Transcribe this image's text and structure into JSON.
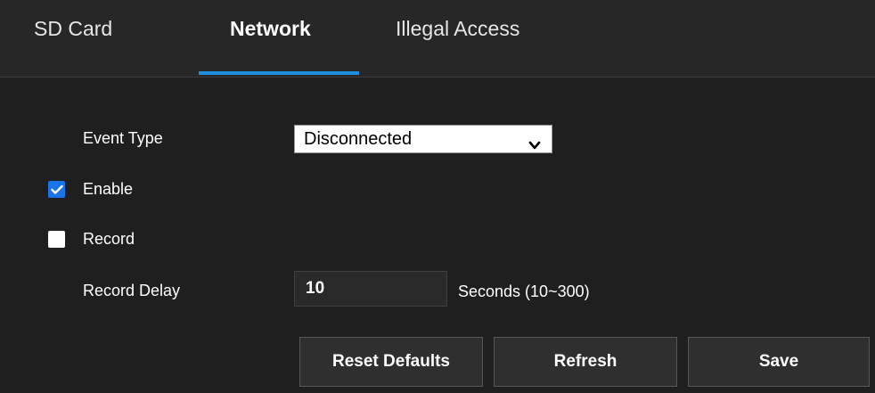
{
  "tabs": {
    "items": [
      {
        "label": "SD Card"
      },
      {
        "label": "Network"
      },
      {
        "label": "Illegal Access"
      }
    ],
    "active": "Network"
  },
  "form": {
    "event_type_label": "Event Type",
    "event_type_value": "Disconnected",
    "enable_label": "Enable",
    "enable_checked": true,
    "record_label": "Record",
    "record_checked": false,
    "record_delay_label": "Record Delay",
    "record_delay_value": "10",
    "record_delay_unit": "Seconds (10~300)"
  },
  "buttons": {
    "reset": "Reset Defaults",
    "refresh": "Refresh",
    "save": "Save"
  },
  "colors": {
    "accent": "#1e8fdf",
    "checkbox_checked": "#1a73e8",
    "background": "#1f1f1f",
    "tabbar": "#272727"
  },
  "icons": {
    "dropdown": "chevron-down-icon",
    "check": "checkmark-icon"
  }
}
